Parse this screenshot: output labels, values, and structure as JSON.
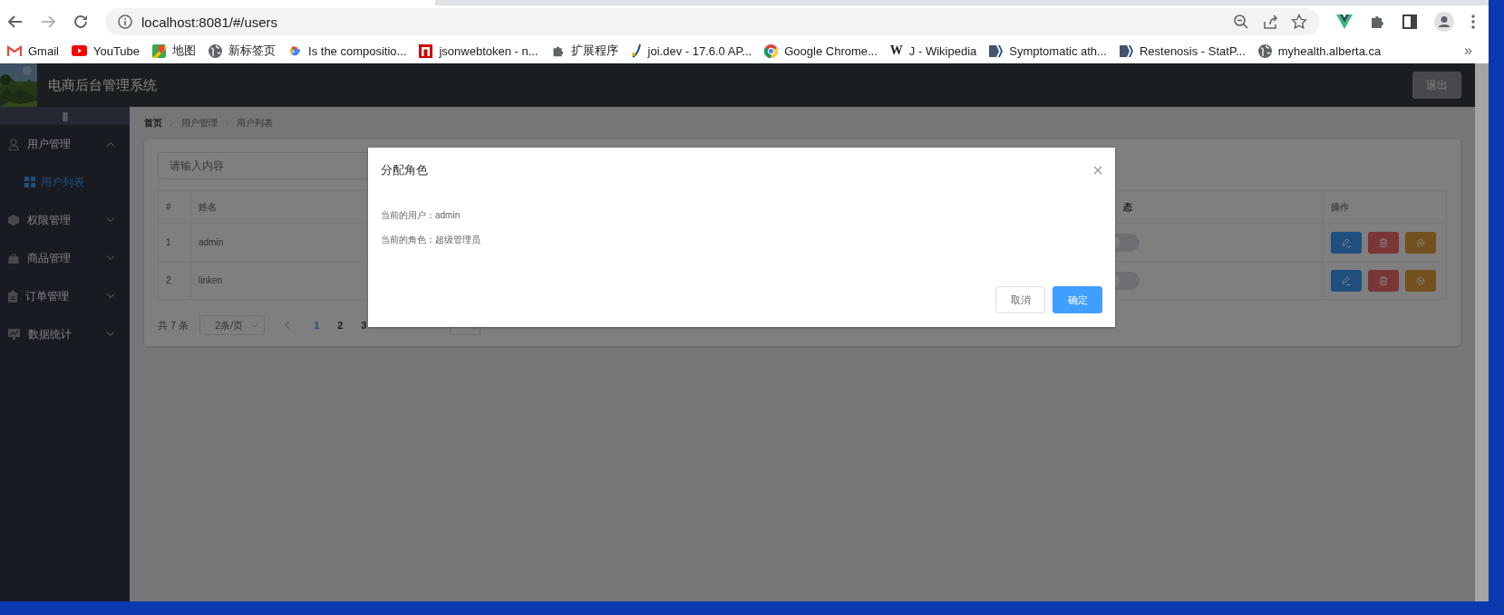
{
  "browser": {
    "url": "localhost:8081/#/users",
    "bookmarks": [
      {
        "label": "Gmail",
        "kind": "mail"
      },
      {
        "label": "YouTube",
        "kind": "video"
      },
      {
        "label": "地图",
        "kind": "map"
      },
      {
        "label": "新标签页",
        "kind": "globe"
      },
      {
        "label": "Is the compositio...",
        "kind": "search"
      },
      {
        "label": "jsonwebtoken - n...",
        "kind": "square"
      },
      {
        "label": "扩展程序",
        "kind": "puzzle"
      },
      {
        "label": "joi.dev - 17.6.0 AP...",
        "kind": "squiggle"
      },
      {
        "label": "Google Chrome...",
        "kind": "browser"
      },
      {
        "label": "J - Wikipedia",
        "kind": "letter",
        "icon_text": "W"
      },
      {
        "label": "Symptomatic ath...",
        "kind": "document"
      },
      {
        "label": "Restenosis - StatP...",
        "kind": "document"
      },
      {
        "label": "myhealth.alberta.ca",
        "kind": "globe"
      }
    ],
    "more": "»"
  },
  "header": {
    "title": "电商后台管理系统",
    "logout": "退出"
  },
  "sidebar": {
    "toggle": "|||",
    "items": [
      {
        "label": "用户管理",
        "kind": "user",
        "expanded": true,
        "children": [
          {
            "label": "用户列表",
            "selected": true
          }
        ]
      },
      {
        "label": "权限管理",
        "kind": "cube",
        "expanded": false
      },
      {
        "label": "商品管理",
        "kind": "bag",
        "expanded": false
      },
      {
        "label": "订单管理",
        "kind": "clipboard",
        "expanded": false
      },
      {
        "label": "数据统计",
        "kind": "chart",
        "expanded": false
      }
    ]
  },
  "breadcrumb": [
    "首页",
    "用户管理",
    "用户列表"
  ],
  "search": {
    "placeholder": "请输入内容"
  },
  "table": {
    "columns": [
      "#",
      "姓名",
      "态",
      "操作"
    ],
    "rows": [
      {
        "index": "1",
        "name": "admin",
        "state_on": false
      },
      {
        "index": "2",
        "name": "linken",
        "state_on": false
      }
    ]
  },
  "pagination": {
    "total": "共 7 条",
    "page_size": "2条/页",
    "pages": [
      {
        "label": "1",
        "selected": true
      },
      {
        "label": "2",
        "selected": false
      },
      {
        "label": "3",
        "selected": false
      }
    ]
  },
  "dialog": {
    "title": "分配角色",
    "lines": [
      "当前的用户：admin",
      "当前的角色：超级管理员"
    ],
    "buttons": [
      {
        "label": "取消",
        "kind": "default"
      },
      {
        "label": "确定",
        "kind": "primary"
      }
    ]
  }
}
